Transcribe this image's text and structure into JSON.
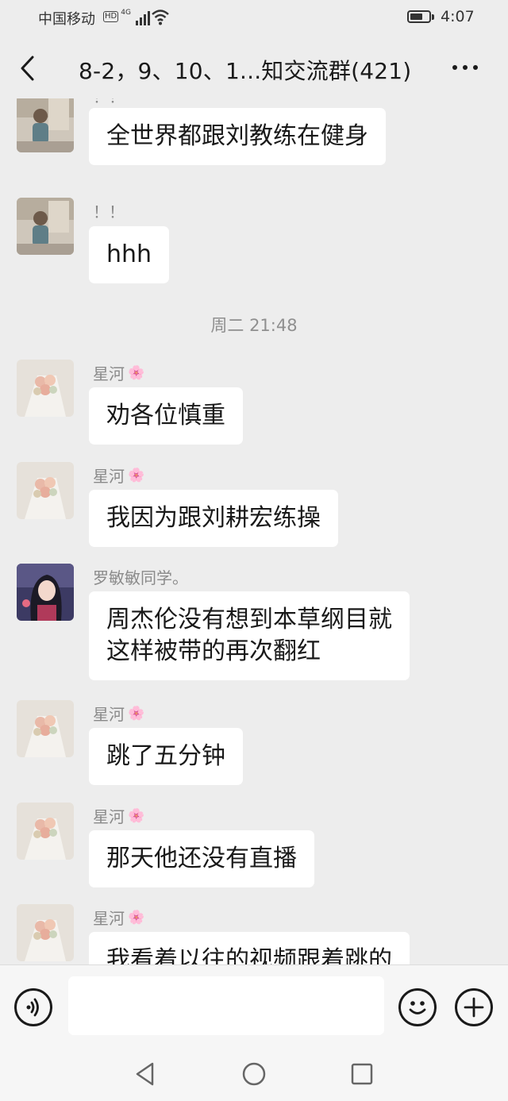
{
  "status_bar": {
    "carrier": "中国移动",
    "network_badge": "HD",
    "network_type": "4G",
    "time": "4:07",
    "battery_level": 0.7
  },
  "header": {
    "title": "8-2，9、10、1...知交流群(421)",
    "back_icon": "chevron-left-icon",
    "more_icon": "more-dots-icon"
  },
  "messages": [
    {
      "sender": "！！",
      "text": "全世界都跟刘教练在健身",
      "avatar": "photo-avatar"
    },
    {
      "sender": "！！",
      "text": "hhh",
      "avatar": "photo-avatar"
    },
    {
      "timestamp": "周二 21:48"
    },
    {
      "sender": "星河",
      "sender_emoji": "🌸",
      "text": "劝各位慎重",
      "avatar": "bouquet-avatar"
    },
    {
      "sender": "星河",
      "sender_emoji": "🌸",
      "text": "我因为跟刘耕宏练操",
      "avatar": "bouquet-avatar"
    },
    {
      "sender": "罗敏敏同学。",
      "text_line1": "周杰伦没有想到本草纲目就",
      "text_line2": "这样被带的再次翻红",
      "avatar": "anime-girl-avatar"
    },
    {
      "sender": "星河",
      "sender_emoji": "🌸",
      "text": "跳了五分钟",
      "avatar": "bouquet-avatar"
    },
    {
      "sender": "星河",
      "sender_emoji": "🌸",
      "text": "那天他还没有直播",
      "avatar": "bouquet-avatar"
    },
    {
      "sender": "星河",
      "sender_emoji": "🌸",
      "text": "我看着以往的视频跟着跳的",
      "avatar": "bouquet-avatar"
    }
  ],
  "input_bar": {
    "voice_icon": "voice-icon",
    "emoji_icon": "emoji-icon",
    "plus_icon": "plus-icon",
    "input_value": ""
  },
  "nav_bar": {
    "back_icon": "nav-back-triangle-icon",
    "home_icon": "nav-home-circle-icon",
    "recents_icon": "nav-recents-square-icon"
  }
}
